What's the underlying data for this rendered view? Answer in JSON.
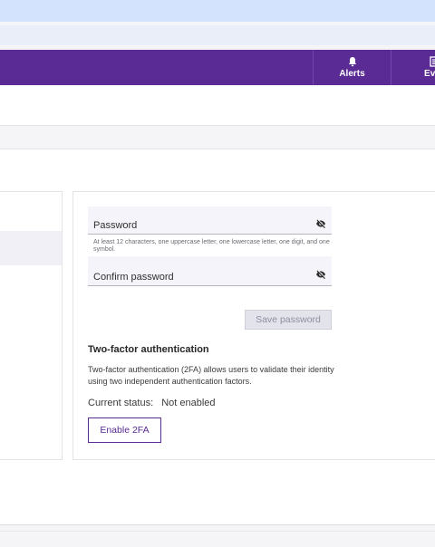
{
  "nav": {
    "alerts_label": "Alerts",
    "events_label": "Even",
    "alerts_icon": "bell-icon",
    "events_icon": "list-icon",
    "color": "#5a2b94"
  },
  "form": {
    "password_label": "Password",
    "password_hint": "At least 12 characters, one uppercase letter, one lowercase letter, one digit, and one symbol.",
    "confirm_label": "Confirm password",
    "visibility_icon": "eye-off-icon",
    "save_label": "Save password"
  },
  "twofa": {
    "title": "Two-factor authentication",
    "description": "Two-factor authentication (2FA) allows users to validate their identity using two independent authentication factors.",
    "status_label": "Current status:",
    "status_value": "Not enabled",
    "enable_label": "Enable 2FA"
  }
}
